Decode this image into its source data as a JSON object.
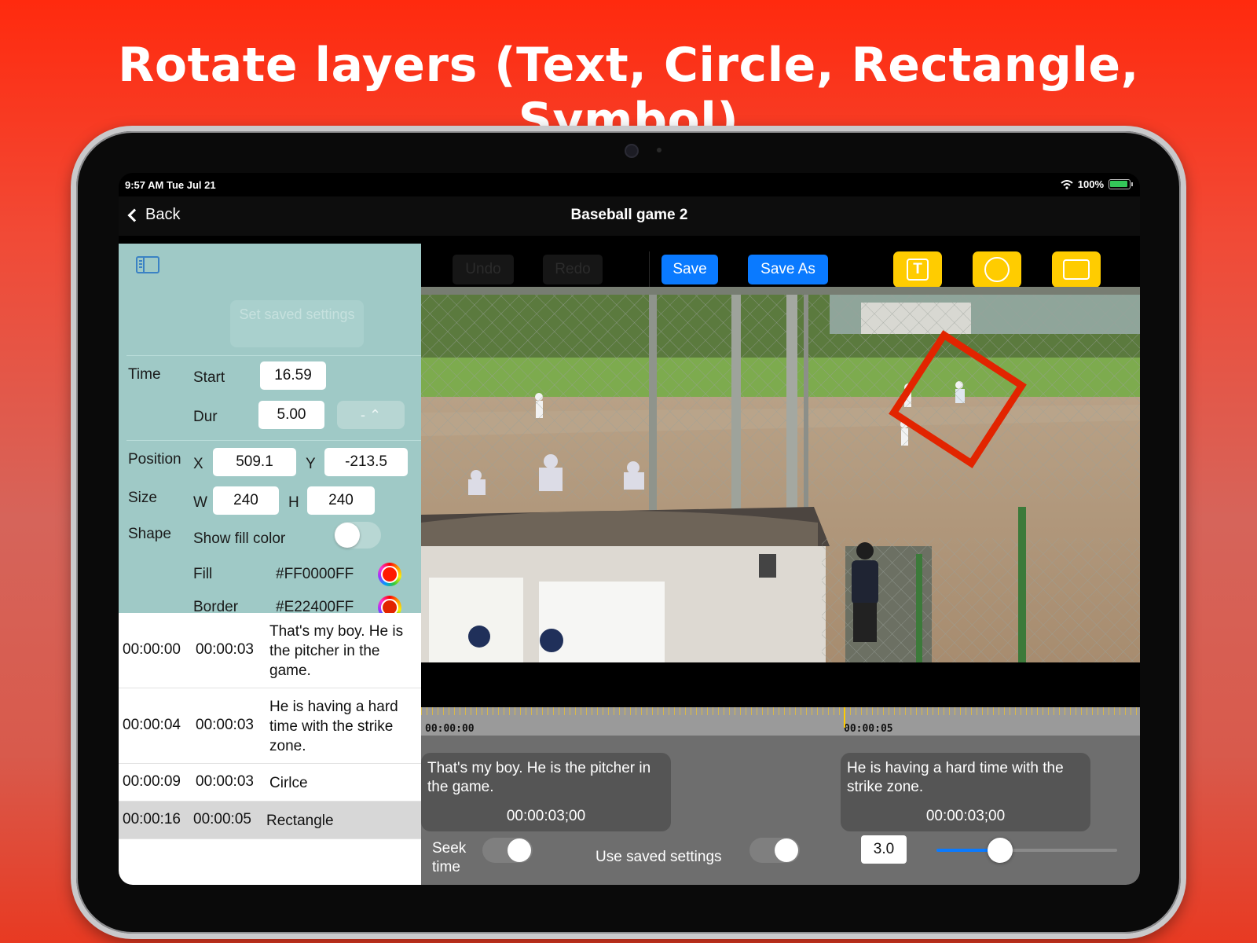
{
  "headline": "Rotate layers (Text, Circle, Rectangle, Symbol)",
  "status_bar": {
    "time": "9:57 AM   Tue Jul 21",
    "battery": "100%"
  },
  "nav": {
    "back_label": "Back",
    "title": "Baseball game 2"
  },
  "left_panel": {
    "set_saved_label": "Set saved settings",
    "time": {
      "section": "Time",
      "start_label": "Start",
      "start_value": "16.59",
      "dur_label": "Dur",
      "dur_value": "5.00",
      "stepper_label": "- ⌃"
    },
    "position": {
      "section": "Position",
      "x_label": "X",
      "x_value": "509.1",
      "y_label": "Y",
      "y_value": "-213.5"
    },
    "size": {
      "section": "Size",
      "w_label": "W",
      "w_value": "240",
      "h_label": "H",
      "h_value": "240"
    },
    "shape": {
      "section": "Shape",
      "show_fill_label": "Show fill color",
      "show_fill_on": false,
      "fill_label": "Fill",
      "fill_value": "#FF0000FF",
      "border_label": "Border",
      "border_value": "#E22400FF"
    }
  },
  "subtitle_list": [
    {
      "start": "00:00:00",
      "duration": "00:00:03",
      "text": "That's my boy.  He is the pitcher in the game."
    },
    {
      "start": "00:00:04",
      "duration": "00:00:03",
      "text": "He is having a hard time with the strike zone."
    },
    {
      "start": "00:00:09",
      "duration": "00:00:03",
      "text": "Cirlce"
    },
    {
      "start": "00:00:16",
      "duration": "00:00:05",
      "text": "Rectangle",
      "selected": true
    }
  ],
  "toolbar": {
    "undo_label": "Undo",
    "redo_label": "Redo",
    "save_label": "Save",
    "save_as_label": "Save As",
    "text_tool_glyph": "T"
  },
  "timeline": {
    "tc_start": "00:00:00",
    "tc_mid": "00:00:05",
    "clips": [
      {
        "text": "That's my boy.  He is the pitcher in the game.",
        "duration": "00:00:03;00"
      },
      {
        "text": "He is having a hard time with the strike zone.",
        "duration": "00:00:03;00"
      }
    ]
  },
  "bottom_bar": {
    "seek_time_label": "Seek time",
    "use_saved_label": "Use saved settings",
    "value": "3.0",
    "slider_fraction": 0.35
  },
  "colors": {
    "accent_blue": "#0a7aff",
    "tool_yellow": "#ffcc00",
    "panel_teal": "#9fc9c6",
    "shape_red": "#e22400"
  },
  "icons": [
    "chevron-left-icon",
    "sidebar-toggle-icon",
    "wifi-icon",
    "battery-icon",
    "text-tool-icon",
    "circle-tool-icon",
    "rectangle-tool-icon"
  ]
}
